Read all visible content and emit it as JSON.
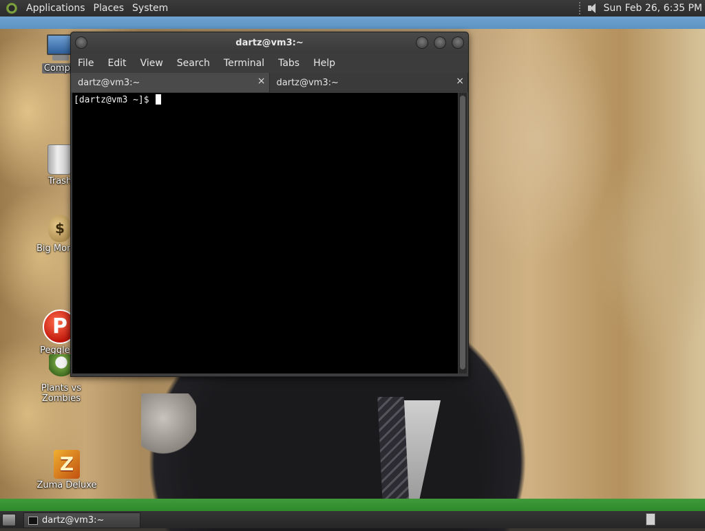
{
  "top_panel": {
    "menus": [
      "Applications",
      "Places",
      "System"
    ],
    "clock": "Sun Feb 26,  6:35 PM",
    "volume_icon": "speaker-icon"
  },
  "desktop": {
    "icons": [
      {
        "label": "Compu",
        "icon": "computer-icon"
      },
      {
        "label": "Trash",
        "icon": "trash-icon"
      },
      {
        "label": "Big Money",
        "icon": "money-bag-icon"
      },
      {
        "label": "Peggle D",
        "icon": "peggle-icon"
      },
      {
        "label": "Plants vs Zombies",
        "icon": "plants-vs-zombies-icon"
      },
      {
        "label": "Zuma Deluxe",
        "icon": "zuma-icon"
      }
    ],
    "icon_glyphs": {
      "money": "$",
      "peggle": "P",
      "zuma": "Z"
    }
  },
  "terminal": {
    "title": "dartz@vm3:~",
    "menu": [
      "File",
      "Edit",
      "View",
      "Search",
      "Terminal",
      "Tabs",
      "Help"
    ],
    "tabs": [
      {
        "label": "dartz@vm3:~",
        "active": false
      },
      {
        "label": "dartz@vm3:~",
        "active": true
      }
    ],
    "tab_close": "×",
    "prompt": "[dartz@vm3 ~]$ "
  },
  "taskbar": {
    "tasks": [
      {
        "label": "dartz@vm3:~",
        "icon": "terminal-icon"
      }
    ]
  }
}
